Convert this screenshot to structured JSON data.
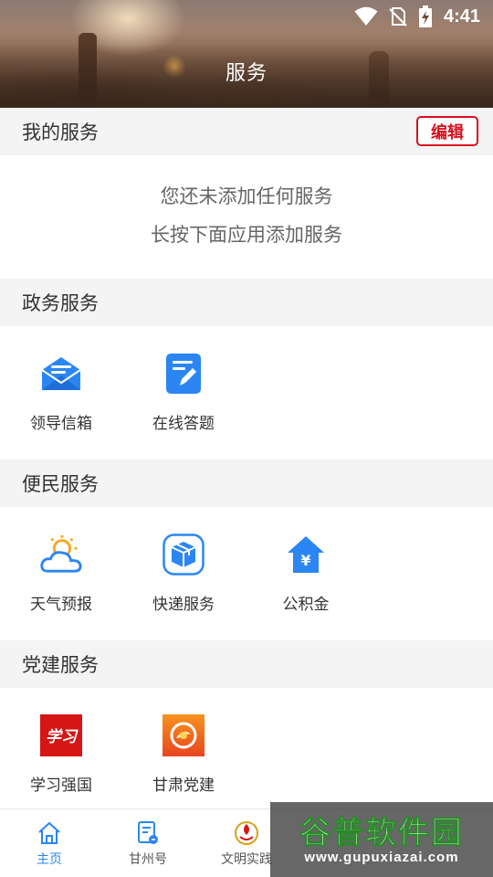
{
  "status_bar": {
    "time": "4:41",
    "icons": [
      "wifi-icon",
      "no-sim-icon",
      "battery-charging-icon"
    ]
  },
  "header": {
    "title": "服务"
  },
  "my_services": {
    "title": "我的服务",
    "edit_label": "编辑",
    "empty_line1": "您还未添加任何服务",
    "empty_line2": "长按下面应用添加服务"
  },
  "gov_services": {
    "title": "政务服务",
    "items": [
      {
        "label": "领导信箱",
        "icon": "mailbox-icon"
      },
      {
        "label": "在线答题",
        "icon": "edit-note-icon"
      }
    ]
  },
  "public_services": {
    "title": "便民服务",
    "items": [
      {
        "label": "天气预报",
        "icon": "weather-icon"
      },
      {
        "label": "快递服务",
        "icon": "package-icon"
      },
      {
        "label": "公积金",
        "icon": "housing-fund-icon"
      }
    ]
  },
  "party_services": {
    "title": "党建服务",
    "items": [
      {
        "label": "学习强国",
        "icon": "xuexi-logo-icon",
        "logo_text": "学习"
      },
      {
        "label": "甘肃党建",
        "icon": "gansu-party-logo-icon"
      }
    ]
  },
  "bottom_nav": {
    "items": [
      {
        "label": "主页",
        "icon": "home-icon"
      },
      {
        "label": "甘州号",
        "icon": "document-icon"
      },
      {
        "label": "文明实践",
        "icon": "civilization-logo-icon"
      }
    ]
  },
  "watermark": {
    "main": "谷普软件园",
    "sub": "www.gupuxiazai.com"
  },
  "colors": {
    "accent_blue": "#2b86f3",
    "edit_red": "#d7111e",
    "section_bg": "#f4f4f4"
  }
}
